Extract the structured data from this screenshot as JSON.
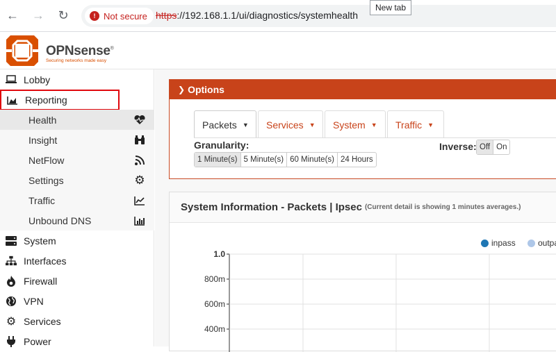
{
  "browser": {
    "security_label": "Not secure",
    "url_scheme": "https",
    "url_rest": "://192.168.1.1/ui/diagnostics/systemhealth",
    "tooltip": "New tab"
  },
  "app": {
    "brand": "OPNsense",
    "registered": "®",
    "tagline": "Securing networks made easy"
  },
  "sidebar": {
    "items": [
      {
        "label": "Lobby",
        "icon": "laptop-icon"
      },
      {
        "label": "Reporting",
        "icon": "area-chart-icon"
      }
    ],
    "subitems": [
      {
        "label": "Health",
        "icon": "heartbeat-icon"
      },
      {
        "label": "Insight",
        "icon": "binoculars-icon"
      },
      {
        "label": "NetFlow",
        "icon": "rss-icon"
      },
      {
        "label": "Settings",
        "icon": "gear-icon"
      },
      {
        "label": "Traffic",
        "icon": "line-chart-icon"
      },
      {
        "label": "Unbound DNS",
        "icon": "bar-chart-icon"
      }
    ],
    "sections": [
      {
        "label": "System",
        "icon": "server-icon"
      },
      {
        "label": "Interfaces",
        "icon": "sitemap-icon"
      },
      {
        "label": "Firewall",
        "icon": "fire-icon"
      },
      {
        "label": "VPN",
        "icon": "globe-icon"
      },
      {
        "label": "Services",
        "icon": "gears-icon"
      },
      {
        "label": "Power",
        "icon": "plug-icon"
      }
    ]
  },
  "options": {
    "title": "Options",
    "tabs": [
      "Packets",
      "Services",
      "System",
      "Traffic"
    ],
    "granularity_label": "Granularity:",
    "granularity": [
      "1 Minute(s)",
      "5 Minute(s)",
      "60 Minute(s)",
      "24 Hours"
    ],
    "inverse_label": "Inverse:",
    "inverse": [
      "Off",
      "On"
    ]
  },
  "panel": {
    "title": "System Information - Packets | Ipsec",
    "note": "(Current detail is showing 1 minutes averages.)"
  },
  "chart_data": {
    "type": "line",
    "series": [
      {
        "name": "inpass",
        "color": "#1f77b4",
        "values": []
      },
      {
        "name": "outpa",
        "color": "#aec7e8",
        "values": []
      }
    ],
    "yticks": [
      "1.0",
      "800m",
      "600m",
      "400m"
    ],
    "ylim": [
      0,
      1.0
    ],
    "grid": true
  },
  "colors": {
    "accent": "#c8431a",
    "highlight_box": "#e0070c"
  }
}
